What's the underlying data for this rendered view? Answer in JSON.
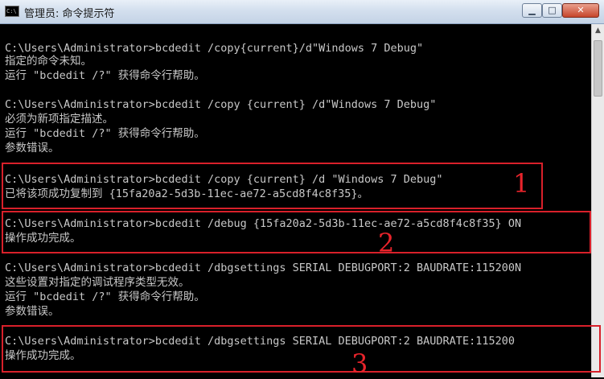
{
  "window": {
    "title": "管理员: 命令提示符",
    "icon_text": "C:\\",
    "buttons": {
      "minimize": "▁",
      "maximize": "□",
      "close": "✕"
    }
  },
  "console": {
    "lines": [
      "C:\\Users\\Administrator>bcdedit /copy{current}/d\"Windows 7 Debug\"",
      "指定的命令未知。",
      "运行 \"bcdedit /?\" 获得命令行帮助。",
      "C:\\Users\\Administrator>bcdedit /copy {current} /d\"Windows 7 Debug\"",
      "必须为新项指定描述。",
      "运行 \"bcdedit /?\" 获得命令行帮助。",
      "参数错误。",
      "C:\\Users\\Administrator>bcdedit /copy {current} /d \"Windows 7 Debug\"",
      "已将该项成功复制到 {15fa20a2-5d3b-11ec-ae72-a5cd8f4c8f35}。",
      "C:\\Users\\Administrator>bcdedit /debug {15fa20a2-5d3b-11ec-ae72-a5cd8f4c8f35} ON",
      "操作成功完成。",
      "C:\\Users\\Administrator>bcdedit /dbgsettings SERIAL DEBUGPORT:2 BAUDRATE:115200N",
      "这些设置对指定的调试程序类型无效。",
      "运行 \"bcdedit /?\" 获得命令行帮助。",
      "参数错误。",
      "C:\\Users\\Administrator>bcdedit /dbgsettings SERIAL DEBUGPORT:2 BAUDRATE:115200",
      "操作成功完成。"
    ]
  },
  "scrollbar": {
    "up_arrow": "▲"
  },
  "annotations": {
    "labels": [
      "1",
      "2",
      "3"
    ],
    "color": "#d8202a"
  },
  "colors": {
    "console_background": "#000000",
    "console_text": "#c8c8c8"
  }
}
